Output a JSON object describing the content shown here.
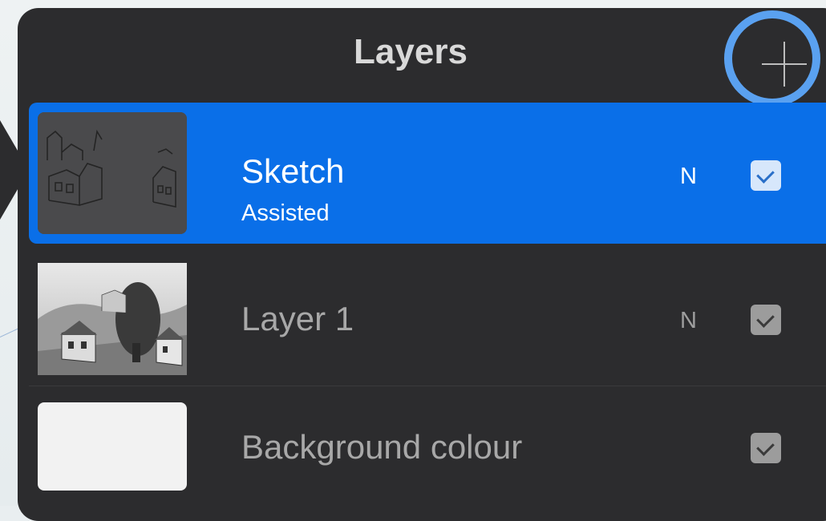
{
  "panel": {
    "title": "Layers",
    "add_icon": "plus-icon"
  },
  "layers": [
    {
      "name": "Sketch",
      "subtitle": "Assisted",
      "blend_mode": "N",
      "visible": true,
      "selected": true
    },
    {
      "name": "Layer 1",
      "blend_mode": "N",
      "visible": true,
      "selected": false
    },
    {
      "name": "Background colour",
      "visible": true,
      "selected": false
    }
  ],
  "colors": {
    "panel_bg": "#2c2c2e",
    "selected_row": "#0a6fe8",
    "highlight_ring": "#5aa1f0"
  }
}
